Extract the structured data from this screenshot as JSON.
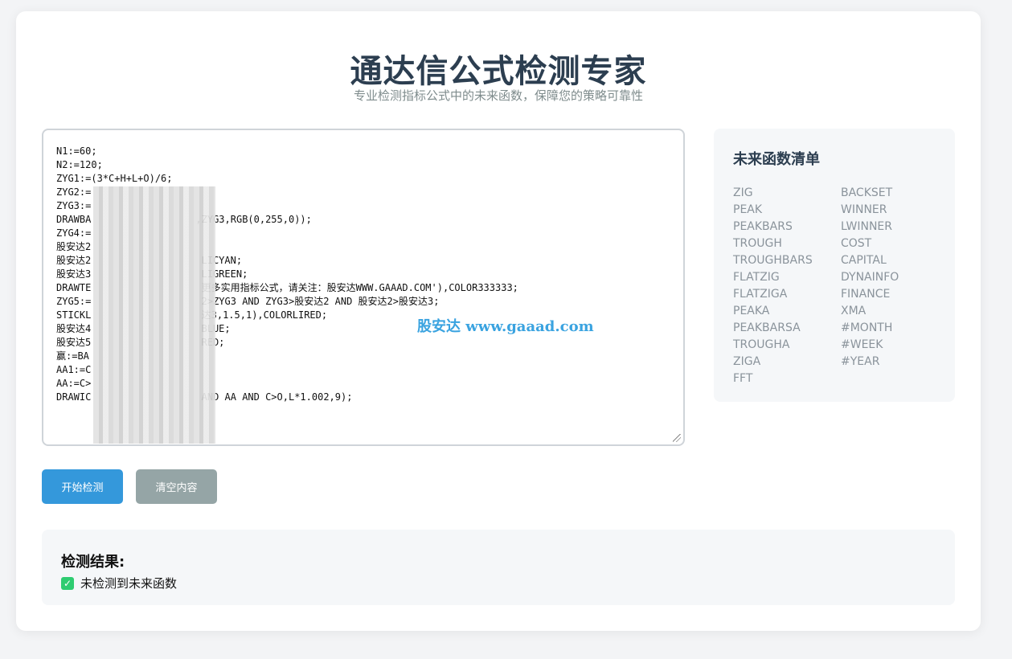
{
  "header": {
    "title": "通达信公式检测专家",
    "subtitle": "专业检测指标公式中的未来函数，保障您的策略可靠性"
  },
  "editor": {
    "code": "N1:=60;\nN2:=120;\nZYG1:=(3*C+H+L+O)/6;\nZYG2:=\nZYG3:=\nDRAWBA                  ,ZYG3,RGB(0,255,0));\nZYG4:=\n股安达2\n股安达2                   LICYAN;\n股安达3                   LIGREEN;\nDRAWTE                   更多实用指标公式，请关注：股安达WWW.GAAAD.COM'),COLOR333333;\nZYG5:=                   2>ZYG3 AND ZYG3>股安达2 AND 股安达2>股安达3;\nSTICKL                   达3,1.5,1),COLORLIRED;\n股安达4                   BLUE;\n股安达5                   RED;\n赢:=BA\nAA1:=C\nAA:=C>\nDRAWIC                   AND AA AND C>O,L*1.002,9);",
    "watermark": "股安达 www.gaaad.com"
  },
  "sidebar": {
    "title": "未来函数清单",
    "functions": [
      "ZIG",
      "BACKSET",
      "PEAK",
      "WINNER",
      "PEAKBARS",
      "LWINNER",
      "TROUGH",
      "COST",
      "TROUGHBARS",
      "CAPITAL",
      "FLATZIG",
      "DYNAINFO",
      "FLATZIGA",
      "FINANCE",
      "PEAKA",
      "XMA",
      "PEAKBARSA",
      "#MONTH",
      "TROUGHA",
      "#WEEK",
      "ZIGA",
      "#YEAR",
      "FFT"
    ]
  },
  "buttons": {
    "start": "开始检测",
    "clear": "清空内容"
  },
  "result": {
    "title": "检测结果:",
    "message": "未检测到未来函数",
    "status_color": "#2ecc71"
  },
  "colors": {
    "primary": "#3498db",
    "secondary": "#95a5a6",
    "heading": "#2c3e50"
  }
}
